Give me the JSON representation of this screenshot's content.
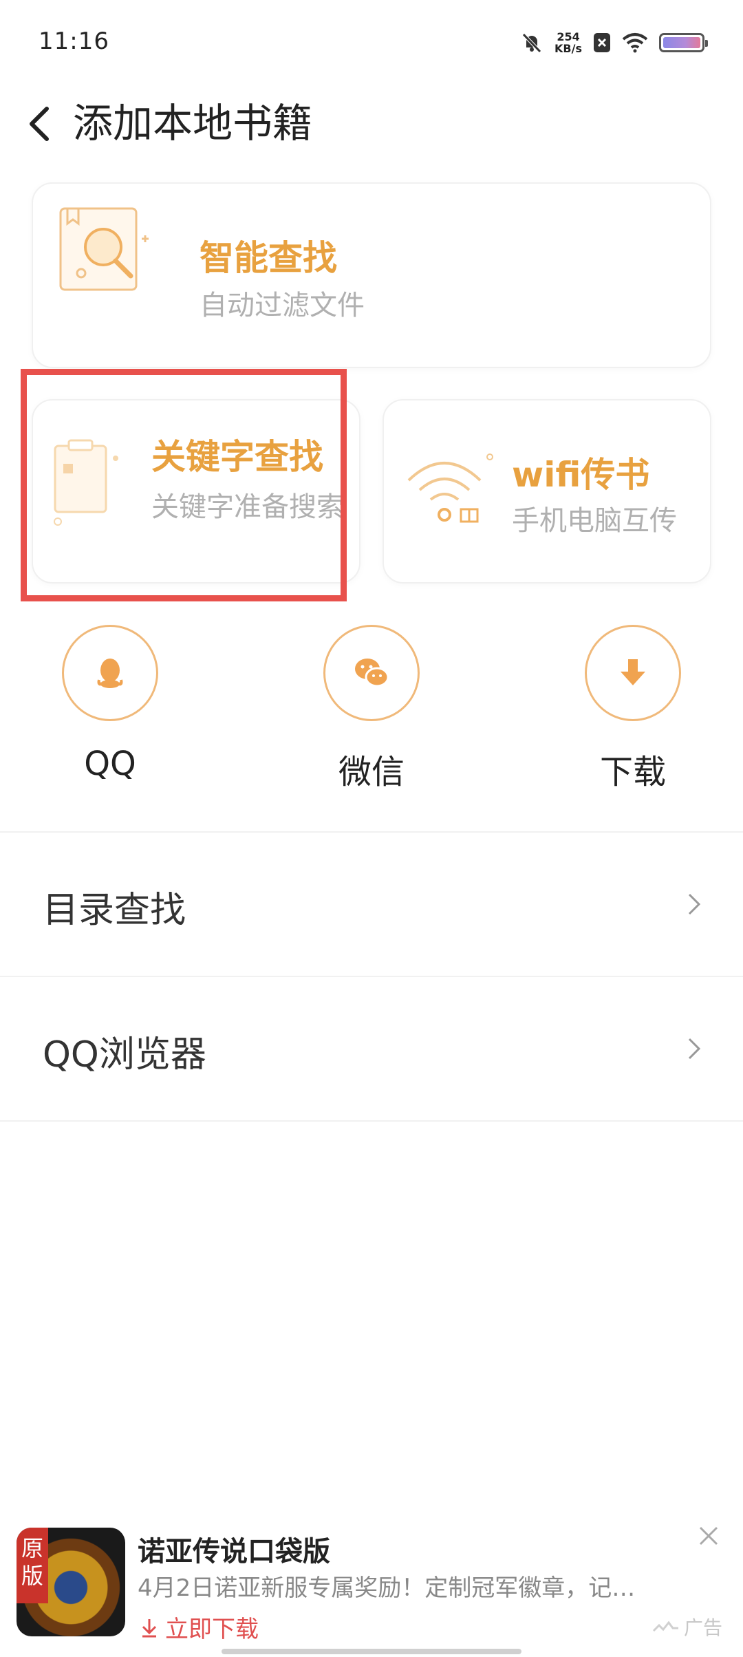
{
  "status_bar": {
    "time": "11:16",
    "speed_value": "254",
    "speed_unit": "KB/s"
  },
  "header": {
    "title": "添加本地书籍"
  },
  "cards": {
    "smart": {
      "title": "智能查找",
      "subtitle": "自动过滤文件"
    },
    "keyword": {
      "title": "关键字查找",
      "subtitle": "关键字准备搜索"
    },
    "wifi": {
      "title": "wifi传书",
      "subtitle": "手机电脑互传"
    }
  },
  "share": [
    {
      "label": "QQ",
      "icon": "qq-icon"
    },
    {
      "label": "微信",
      "icon": "wechat-icon"
    },
    {
      "label": "下载",
      "icon": "download-icon"
    }
  ],
  "list": [
    {
      "label": "目录查找"
    },
    {
      "label": "QQ浏览器"
    }
  ],
  "ad": {
    "badge": "原版",
    "title": "诺亚传说口袋版",
    "description": "4月2日诺亚新服专属奖励！定制冠军徽章，记…",
    "cta": "立即下载",
    "tag": "广告"
  },
  "colors": {
    "accent": "#e8a13f",
    "highlight": "#e8514c",
    "cta": "#e05050"
  }
}
